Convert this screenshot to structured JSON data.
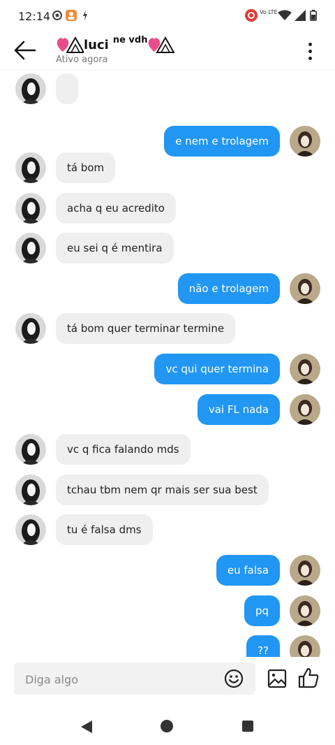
{
  "status_bar": {
    "time": "12:14",
    "network_label": "Vo LTE"
  },
  "header": {
    "name": "luci",
    "name_suffix": "ne vdh",
    "presence": "Ativo agora"
  },
  "messages": [
    {
      "side": "in",
      "text": ""
    },
    {
      "side": "out",
      "text": "e nem e trolagem"
    },
    {
      "side": "in",
      "text": "tá bom"
    },
    {
      "side": "in",
      "text": "acha q eu acredito"
    },
    {
      "side": "in",
      "text": "eu sei q é mentira"
    },
    {
      "side": "out",
      "text": "não e trolagem"
    },
    {
      "side": "in",
      "text": "tá bom quer terminar termine"
    },
    {
      "side": "out",
      "text": "vc qui quer termina"
    },
    {
      "side": "out",
      "text": "vai FL nada"
    },
    {
      "side": "in",
      "text": "vc q fica falando mds"
    },
    {
      "side": "in",
      "text": "tchau tbm nem qr mais ser sua best"
    },
    {
      "side": "in",
      "text": "tu é falsa dms"
    },
    {
      "side": "out",
      "text": "eu falsa"
    },
    {
      "side": "out",
      "text": "pq"
    },
    {
      "side": "out",
      "text": "??"
    }
  ],
  "composer": {
    "placeholder": "Diga algo"
  },
  "colors": {
    "outgoing": "#2196f3",
    "incoming": "#efefef",
    "accent_heart": "#e84d8a"
  },
  "icons": [
    "back-arrow-icon",
    "more-vert-icon",
    "emoji-icon",
    "image-icon",
    "like-icon",
    "nav-back-icon",
    "nav-home-icon",
    "nav-recents-icon"
  ]
}
